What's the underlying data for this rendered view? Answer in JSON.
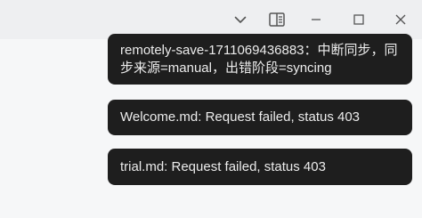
{
  "window": {
    "controls": [
      {
        "icon": "chevron-down-icon"
      },
      {
        "icon": "sidebar-panel-icon"
      },
      {
        "icon": "minimize-icon"
      },
      {
        "icon": "maximize-icon"
      },
      {
        "icon": "close-icon"
      }
    ]
  },
  "notices": [
    {
      "text": "remotely-save-1711069436883：中断同步，同步来源=manual，出错阶段=syncing"
    },
    {
      "text": "Welcome.md: Request failed, status 403"
    },
    {
      "text": "trial.md: Request failed, status 403"
    }
  ],
  "colors": {
    "notice_background": "#1e1e1e",
    "notice_text": "#ececec",
    "titlebar": "#eeeff1",
    "icon": "#555555"
  }
}
